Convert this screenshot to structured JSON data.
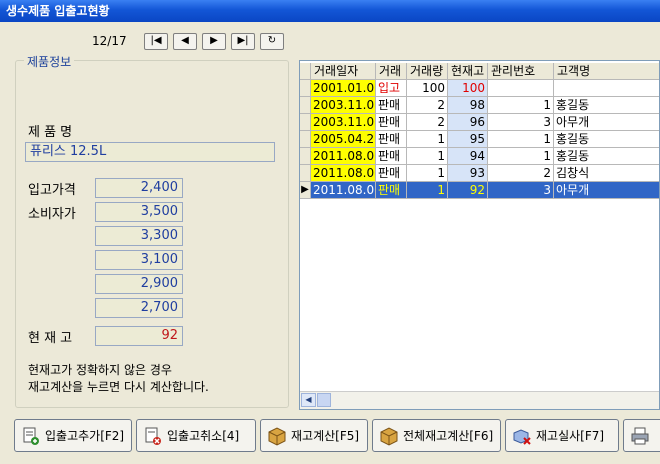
{
  "window": {
    "title": "생수제품 입출고현황"
  },
  "nav": {
    "counter": "12/17",
    "buttons": [
      {
        "name": "first-record-button",
        "glyph": "|◀"
      },
      {
        "name": "prev-record-button",
        "glyph": "◀"
      },
      {
        "name": "next-record-button",
        "glyph": "▶"
      },
      {
        "name": "last-record-button",
        "glyph": "▶|"
      },
      {
        "name": "refresh-button",
        "glyph": "↻"
      }
    ]
  },
  "product": {
    "group_title": "제품정보",
    "name_label": "제 품 명",
    "name_value": "퓨리스 12.5L",
    "in_price_label": "입고가격",
    "in_price": "2,400",
    "consumer_label": "소비자가",
    "consumer_prices": [
      "3,500",
      "3,300",
      "3,100",
      "2,900",
      "2,700"
    ],
    "stock_label": "현 재 고",
    "stock_value": "92",
    "note_line1": "현재고가 정확하지 않은 경우",
    "note_line2": "재고계산을 누르면 다시 계산합니다."
  },
  "grid": {
    "columns": [
      "거래일자",
      "거래",
      "거래량",
      "현재고",
      "관리번호",
      "고객명"
    ],
    "rows": [
      {
        "date": "2001.01.01",
        "type": "입고",
        "qty": "100",
        "stock": "100",
        "mgmt": "",
        "customer": ""
      },
      {
        "date": "2003.11.07",
        "type": "판매",
        "qty": "2",
        "stock": "98",
        "mgmt": "1",
        "customer": "홍길동"
      },
      {
        "date": "2003.11.07",
        "type": "판매",
        "qty": "2",
        "stock": "96",
        "mgmt": "3",
        "customer": "아무개"
      },
      {
        "date": "2005.04.25",
        "type": "판매",
        "qty": "1",
        "stock": "95",
        "mgmt": "1",
        "customer": "홍길동"
      },
      {
        "date": "2011.08.06",
        "type": "판매",
        "qty": "1",
        "stock": "94",
        "mgmt": "1",
        "customer": "홍길동"
      },
      {
        "date": "2011.08.06",
        "type": "판매",
        "qty": "1",
        "stock": "93",
        "mgmt": "2",
        "customer": "김창식"
      },
      {
        "date": "2011.08.06",
        "type": "판매",
        "qty": "1",
        "stock": "92",
        "mgmt": "3",
        "customer": "아무개"
      }
    ],
    "selected_row": 6,
    "row_marker": "▶",
    "scroll_left": "◀"
  },
  "actions": [
    {
      "name": "add-inout-button",
      "label": "입출고추가[F2]",
      "icon": "add-document-icon"
    },
    {
      "name": "cancel-inout-button",
      "label": "입출고취소[4]",
      "icon": "cancel-document-icon"
    },
    {
      "name": "calc-stock-button",
      "label": "재고계산[F5]",
      "icon": "box-icon"
    },
    {
      "name": "calc-all-stock-button",
      "label": "전체재고계산[F6]",
      "icon": "box-icon"
    },
    {
      "name": "stock-audit-button",
      "label": "재고실사[F7]",
      "icon": "audit-icon"
    },
    {
      "name": "print-button",
      "label": "",
      "icon": "printer-icon"
    }
  ],
  "colors": {
    "title_bar": "#0a46c4",
    "date_cell": "#ffff00",
    "stock_cell": "#d7e4f8",
    "selected_row": "#3166c6",
    "selected_text": "#ffff00",
    "inbound_text": "#e00000",
    "price_text": "#1f3ea0"
  }
}
